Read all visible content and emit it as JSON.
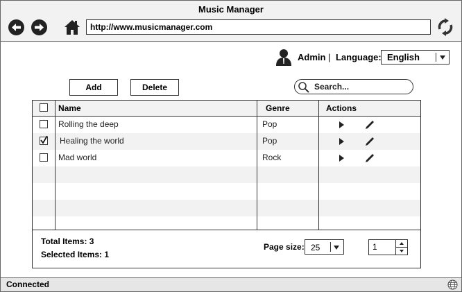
{
  "window": {
    "title": "Music Manager"
  },
  "browser": {
    "url": "http://www.musicmanager.com"
  },
  "user": {
    "name": "Admin",
    "separator": "|",
    "language_label": "Language:",
    "language": "English"
  },
  "toolbar": {
    "add_label": "Add",
    "delete_label": "Delete",
    "search_placeholder": "Search..."
  },
  "table": {
    "headers": {
      "name": "Name",
      "genre": "Genre",
      "actions": "Actions"
    },
    "rows": [
      {
        "name": "Rolling the deep",
        "genre": "Pop",
        "checked": false
      },
      {
        "name": "Healing the world",
        "genre": "Pop",
        "checked": true
      },
      {
        "name": "Mad world",
        "genre": "Rock",
        "checked": false
      }
    ]
  },
  "footer": {
    "total_items": "Total Items: 3",
    "selected_items": "Selected Items: 1",
    "page_size_label": "Page size:",
    "page_size": "25",
    "page": "1"
  },
  "status": {
    "text": "Connected"
  },
  "icons": {
    "back": "back-arrow-icon",
    "forward": "forward-arrow-icon",
    "home": "home-icon",
    "refresh": "refresh-icon",
    "user": "user-icon",
    "search": "search-icon",
    "play": "play-icon",
    "edit": "pencil-icon",
    "globe": "globe-icon"
  }
}
